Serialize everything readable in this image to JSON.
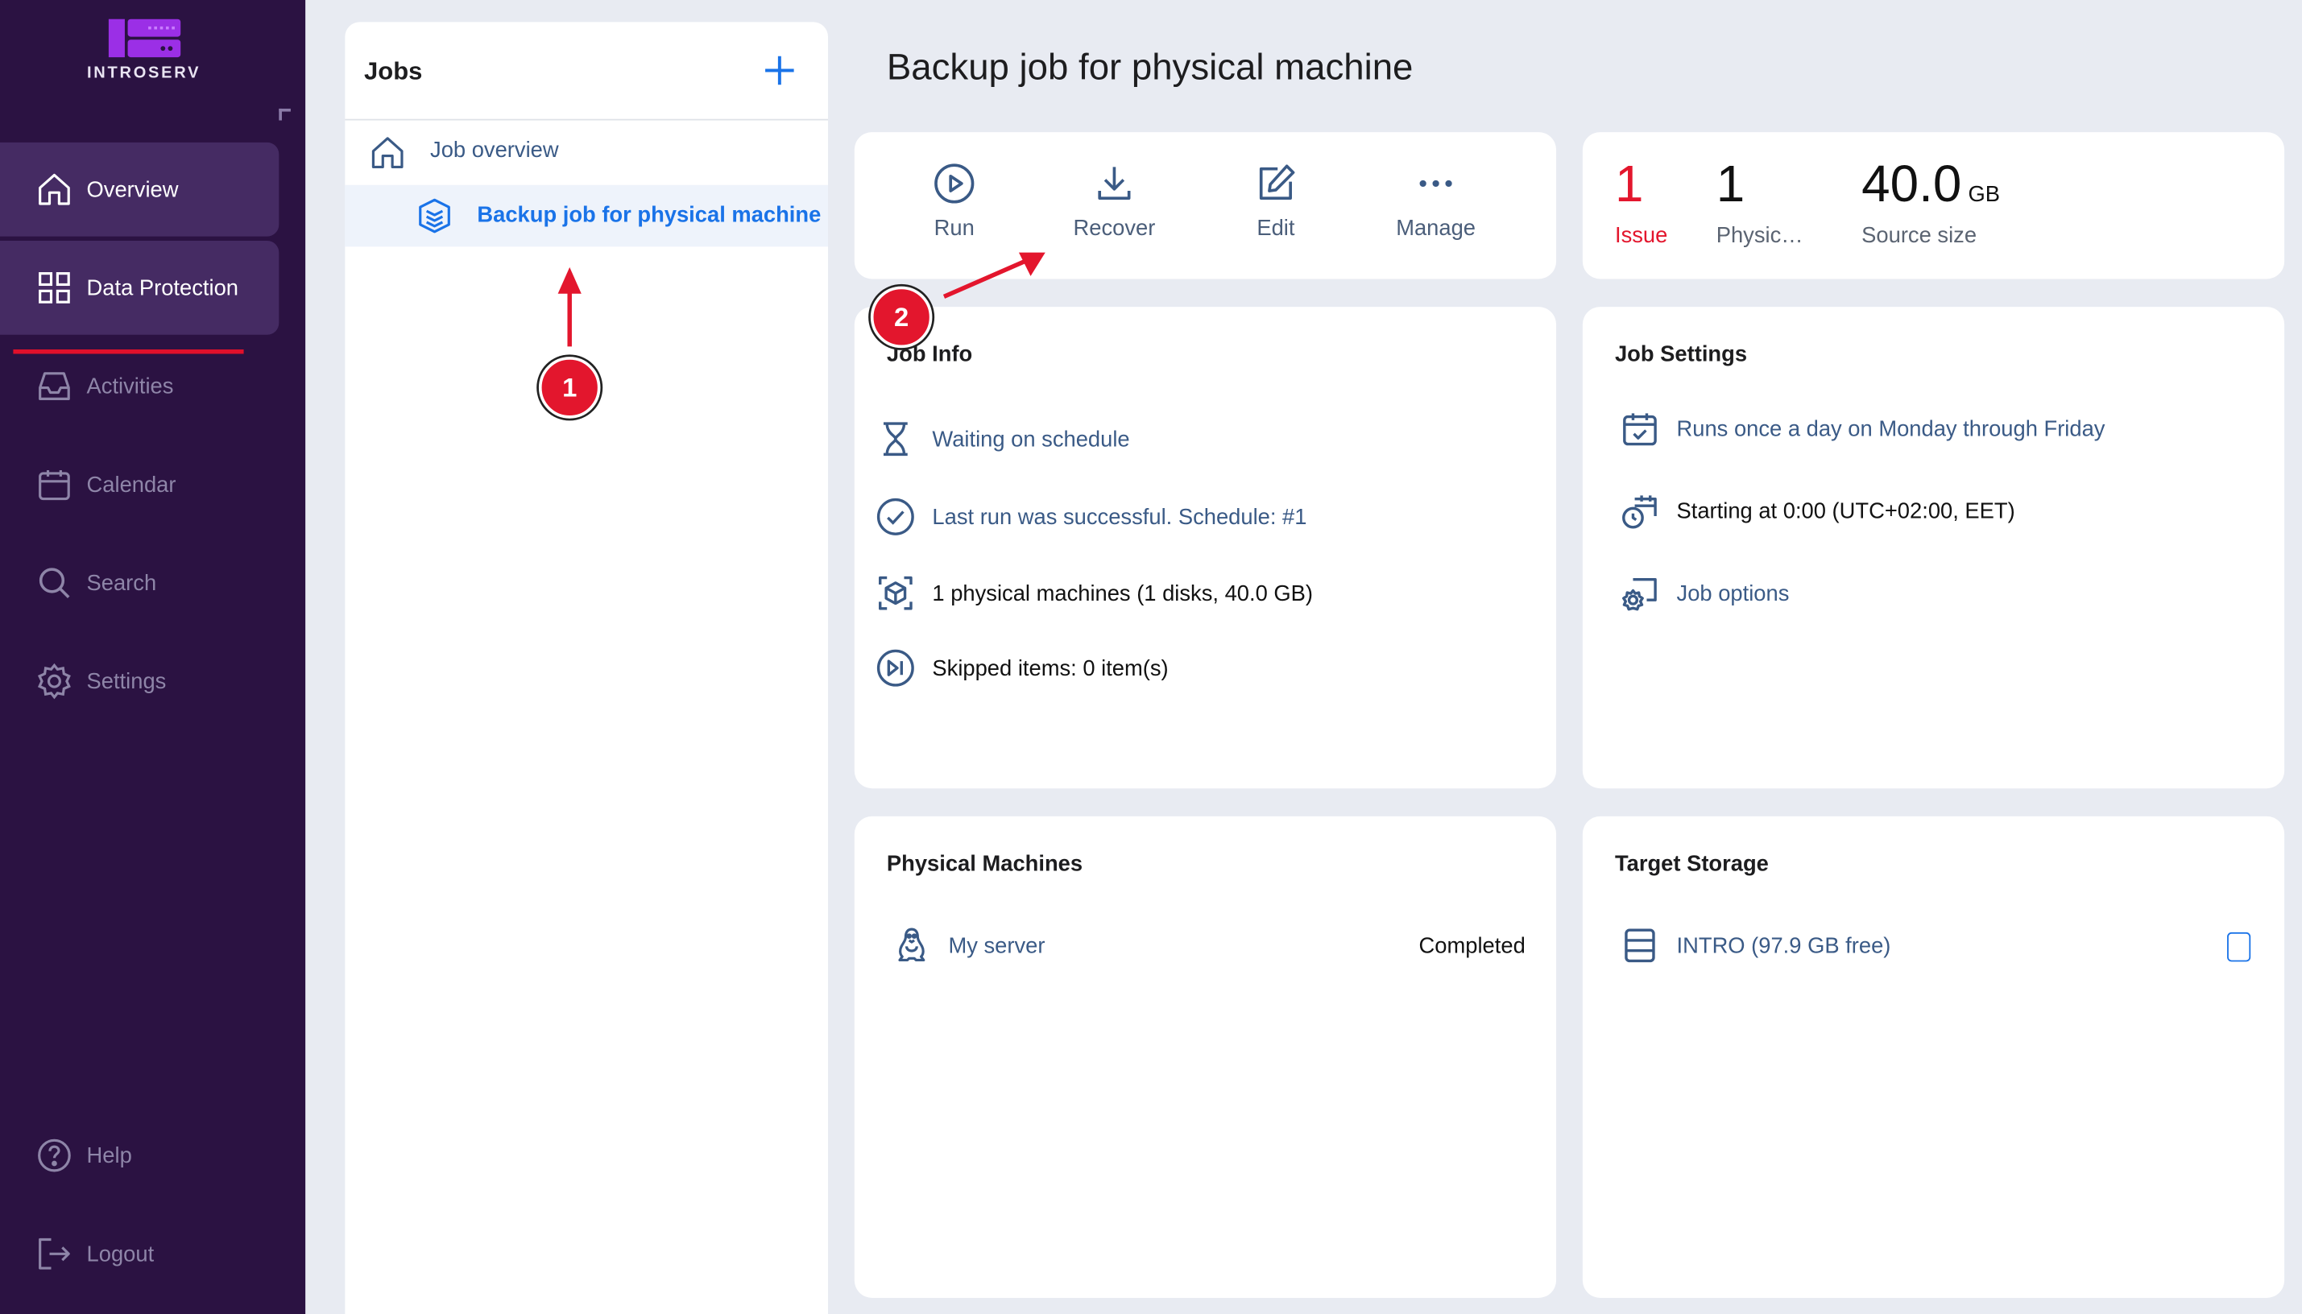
{
  "brand": {
    "name": "INTROSERV"
  },
  "sidebar": {
    "items": [
      {
        "label": "Overview",
        "icon": "home-icon"
      },
      {
        "label": "Data Protection",
        "icon": "grid-icon"
      },
      {
        "label": "Activities",
        "icon": "inbox-icon"
      },
      {
        "label": "Calendar",
        "icon": "calendar-icon"
      },
      {
        "label": "Search",
        "icon": "search-icon"
      },
      {
        "label": "Settings",
        "icon": "gear-icon"
      }
    ],
    "bottom": [
      {
        "label": "Help",
        "icon": "help-icon"
      },
      {
        "label": "Logout",
        "icon": "logout-icon"
      }
    ]
  },
  "jobs": {
    "title": "Jobs",
    "overview_label": "Job overview",
    "selected_job": "Backup job for physical machine"
  },
  "page": {
    "title": "Backup job for physical machine"
  },
  "toolbar": {
    "run": "Run",
    "recover": "Recover",
    "edit": "Edit",
    "manage": "Manage"
  },
  "stats": {
    "issue": {
      "value": "1",
      "label": "Issue"
    },
    "physical": {
      "value": "1",
      "label": "Physic…"
    },
    "source": {
      "value": "40.0",
      "unit": "GB",
      "label": "Source size"
    }
  },
  "job_info": {
    "title": "Job Info",
    "status": "Waiting on schedule",
    "last_run": "Last run was successful. Schedule: #1",
    "machines": "1 physical machines (1 disks, 40.0 GB)",
    "skipped": "Skipped items: 0 item(s)"
  },
  "job_settings": {
    "title": "Job Settings",
    "schedule": "Runs once a day on Monday through Friday",
    "start": "Starting at 0:00 (UTC+02:00, EET)",
    "options": "Job options"
  },
  "physical_machines": {
    "title": "Physical Machines",
    "items": [
      {
        "name": "My server",
        "status": "Completed"
      }
    ]
  },
  "target_storage": {
    "title": "Target Storage",
    "items": [
      {
        "name": "INTRO (97.9 GB free)"
      }
    ]
  },
  "annotations": {
    "marker1": "1",
    "marker2": "2"
  },
  "colors": {
    "sidebar": "#2b1242",
    "accent": "#1a73e8",
    "issue": "#e3162d",
    "marker": "#e3162d"
  }
}
